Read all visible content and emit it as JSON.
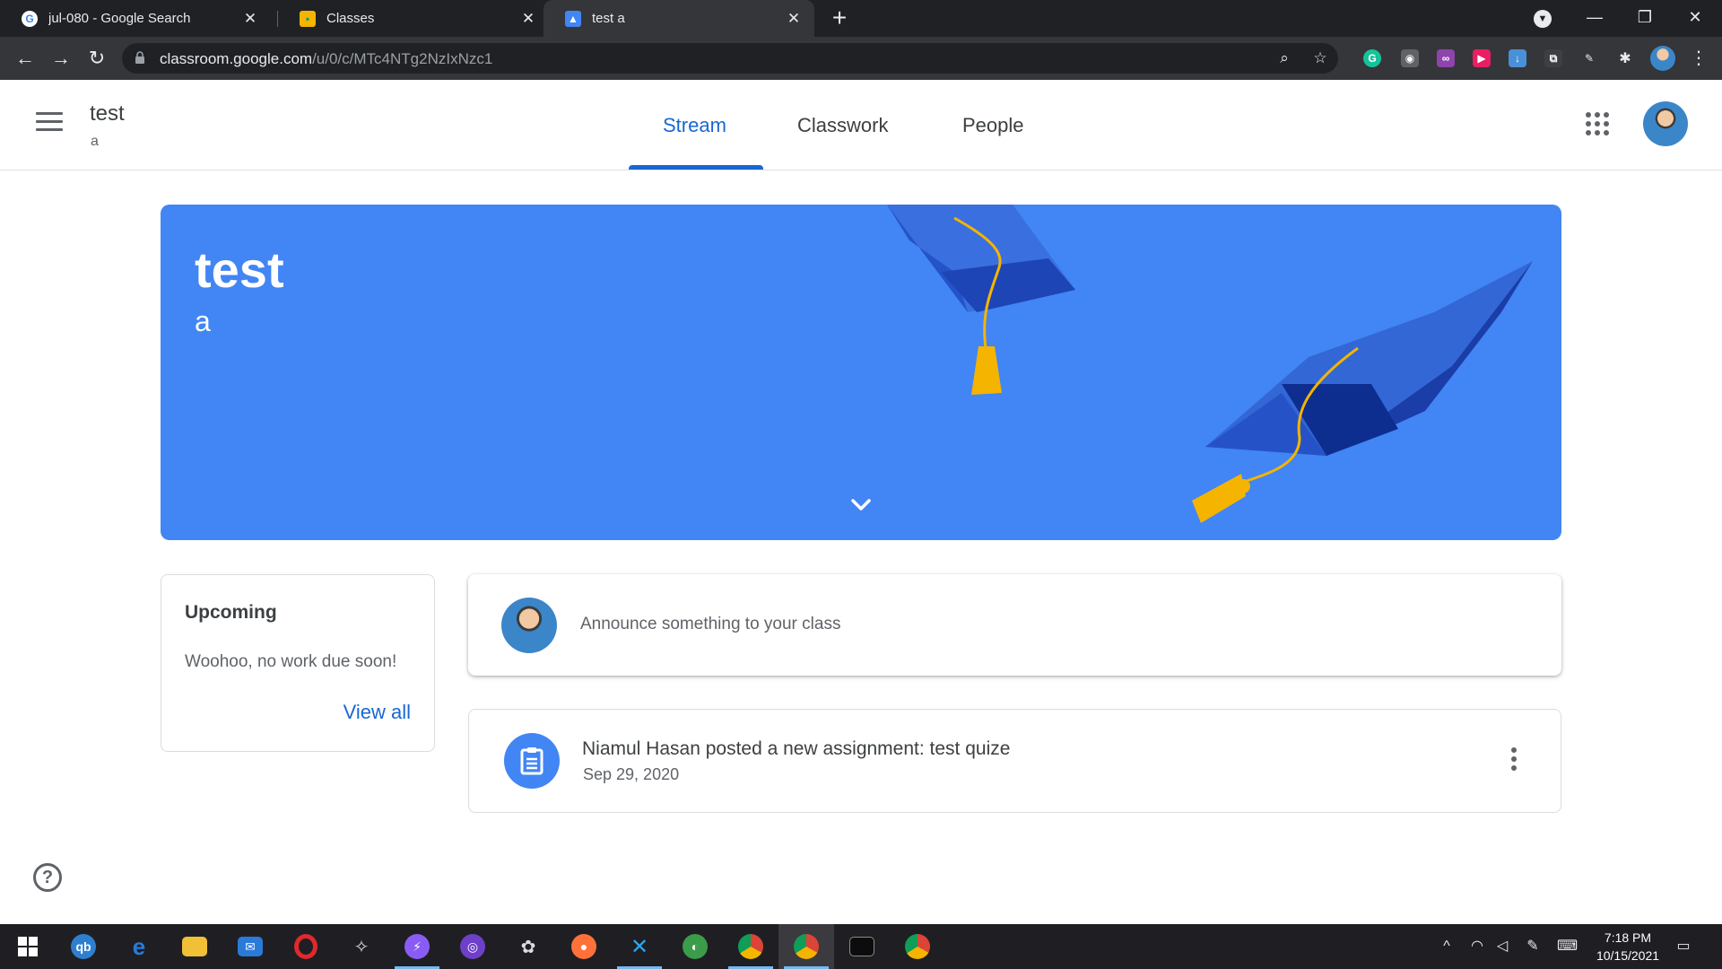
{
  "browser": {
    "tabs": [
      {
        "title": "jul-080 - Google Search",
        "favicon": "google-g-icon"
      },
      {
        "title": "Classes",
        "favicon": "classroom-icon"
      },
      {
        "title": "test a",
        "favicon": "classroom-course-icon"
      }
    ],
    "active_tab_index": 2,
    "url_host": "classroom.google.com",
    "url_path": "/u/0/c/MTc4NTg2NzIxNzc1"
  },
  "header": {
    "class_name": "test",
    "section": "a",
    "tabs": [
      "Stream",
      "Classwork",
      "People"
    ],
    "active_tab": "Stream"
  },
  "banner": {
    "title": "test",
    "section": "a",
    "color": "#4285f4"
  },
  "upcoming": {
    "title": "Upcoming",
    "empty_text": "Woohoo, no work due soon!",
    "view_all": "View all"
  },
  "announce": {
    "placeholder": "Announce something to your class"
  },
  "posts": [
    {
      "title": "Niamul Hasan posted a new assignment: test quize",
      "date": "Sep 29, 2020",
      "icon": "assignment-icon"
    }
  ],
  "taskbar": {
    "time": "7:18 PM",
    "date": "10/15/2021"
  },
  "colors": {
    "accent": "#1967d2",
    "banner": "#4285f4"
  }
}
